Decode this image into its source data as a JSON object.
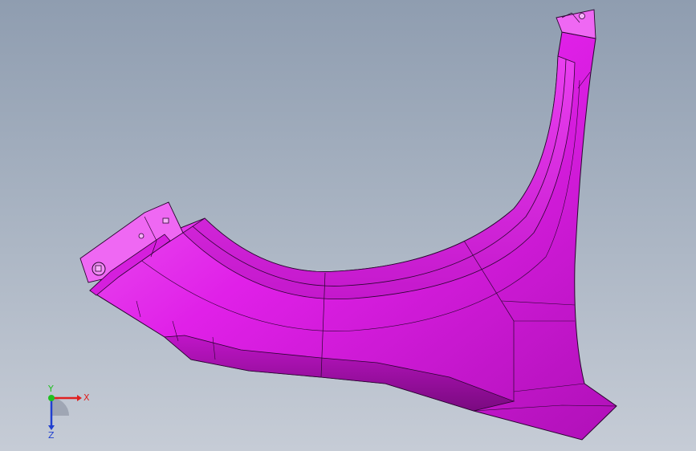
{
  "viewport": {
    "part": "fender-model",
    "colors": {
      "part_fill": "#e020e8",
      "part_highlight": "#f070f5",
      "part_shadow": "#9a0fa0",
      "edge": "#2a0530",
      "bg_top": "#8f9db0",
      "bg_bottom": "#c6ccd6"
    }
  },
  "triad": {
    "x_label": "X",
    "y_label": "Y",
    "z_label": "Z",
    "colors": {
      "x": "#e02020",
      "y": "#20c020",
      "z": "#2040d0"
    }
  }
}
